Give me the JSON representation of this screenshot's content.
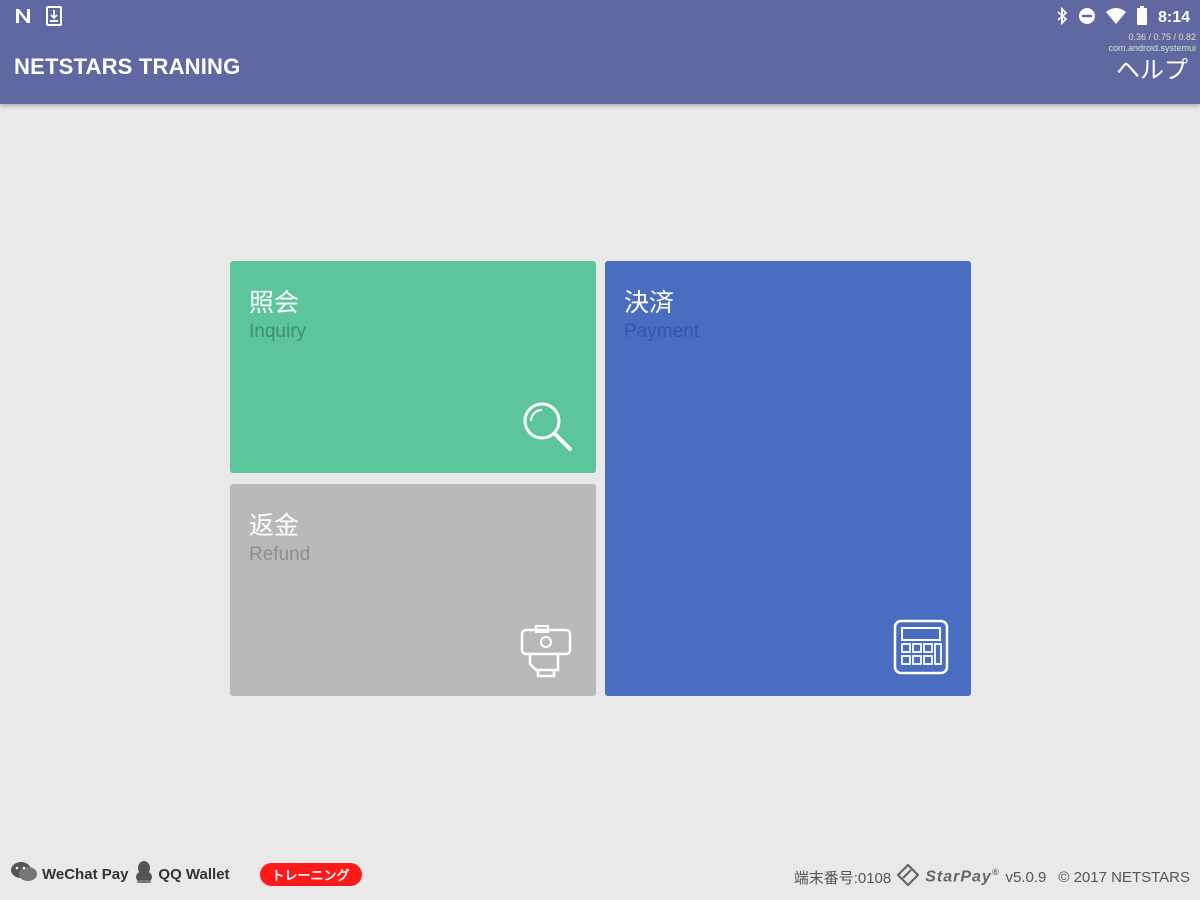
{
  "status_bar": {
    "time": "8:14",
    "debug_line1": "0.36 / 0.75 / 0.82",
    "debug_line2": "com.android.systemui",
    "left_icons": [
      "n-notification-icon",
      "download-icon"
    ],
    "right_icons": [
      "bluetooth-icon",
      "do-not-disturb-icon",
      "wifi-icon",
      "battery-icon"
    ]
  },
  "app_bar": {
    "title": "NETSTARS TRANING",
    "help_label": "ヘルプ",
    "color": "#5f68a0"
  },
  "tiles": {
    "inquiry": {
      "jp": "照会",
      "en": "Inquiry",
      "icon": "search-icon",
      "color": "#5cc59b"
    },
    "refund": {
      "jp": "返金",
      "en": "Refund",
      "icon": "cash-register-icon",
      "color": "#b9b9b9"
    },
    "payment": {
      "jp": "決済",
      "en": "Payment",
      "icon": "calculator-icon",
      "color": "#4a6dc1"
    }
  },
  "footer": {
    "wechat_label": "WeChat Pay",
    "qq_label": "QQ Wallet",
    "training_badge": "トレーニング",
    "badge_color": "#ff1a1a",
    "terminal_label": "端末番号:0108",
    "brand": "StarPay",
    "version": "v5.0.9",
    "copyright": "© 2017 NETSTARS"
  }
}
